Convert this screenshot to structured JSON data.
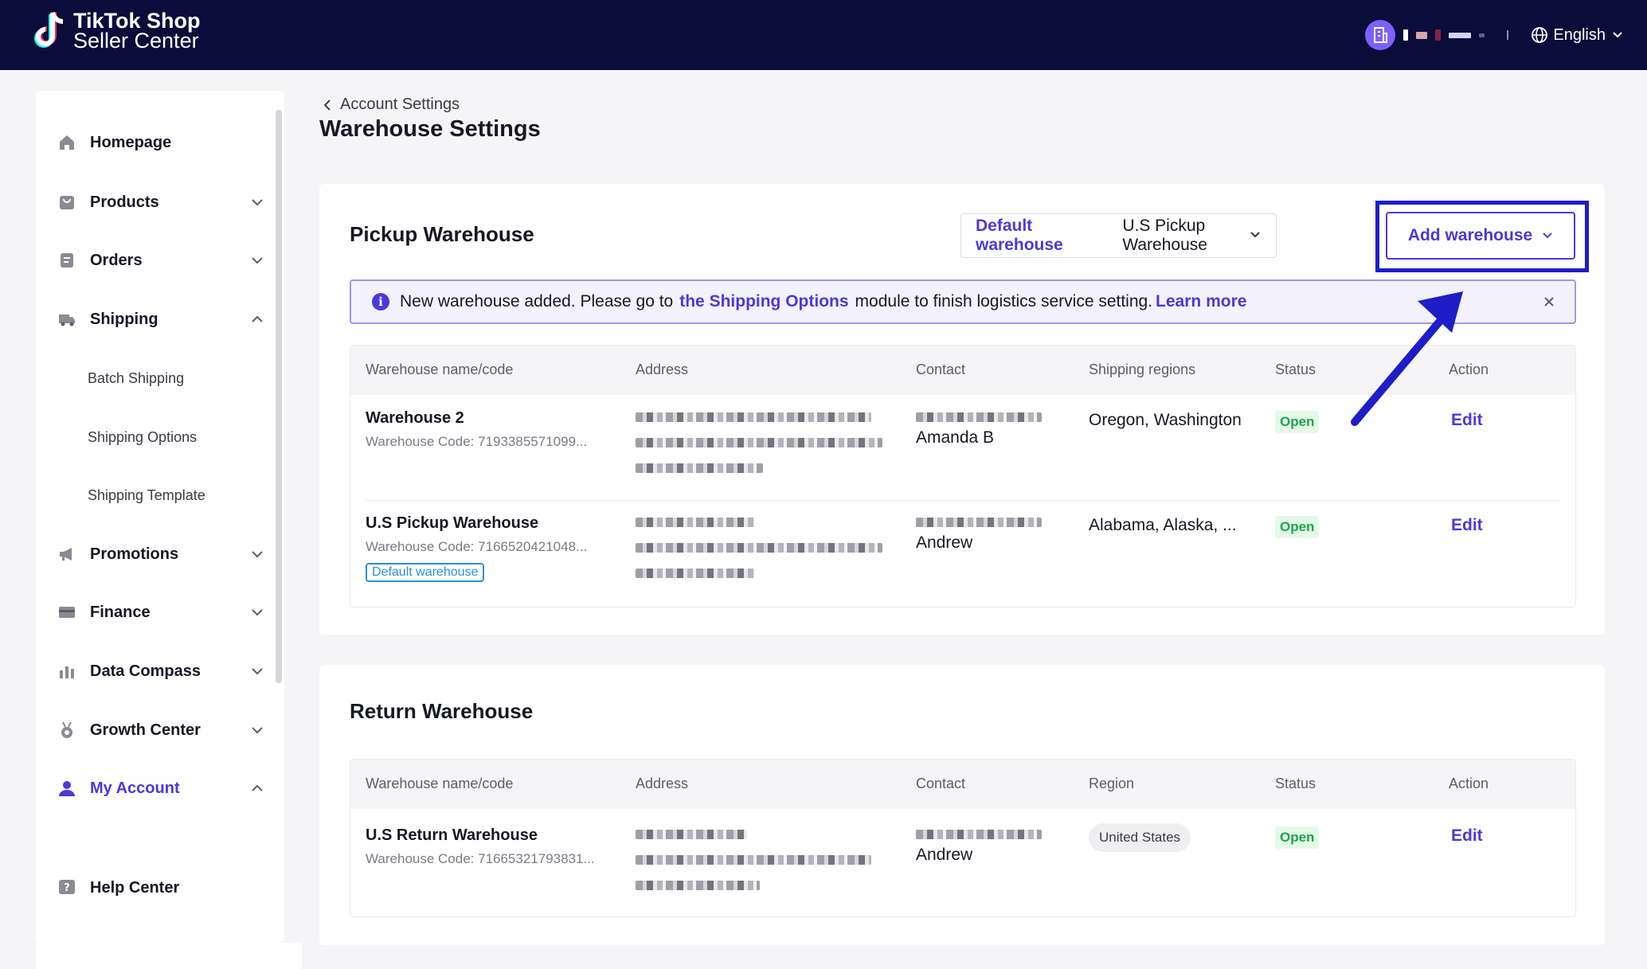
{
  "header": {
    "brand_line1": "TikTok Shop",
    "brand_line2": "Seller Center",
    "language": "English"
  },
  "sidebar": {
    "items": [
      {
        "label": "Homepage"
      },
      {
        "label": "Products"
      },
      {
        "label": "Orders"
      },
      {
        "label": "Shipping"
      },
      {
        "label": "Promotions"
      },
      {
        "label": "Finance"
      },
      {
        "label": "Data Compass"
      },
      {
        "label": "Growth Center"
      },
      {
        "label": "My Account"
      },
      {
        "label": "Help Center"
      }
    ],
    "shipping_subitems": [
      {
        "label": "Batch Shipping"
      },
      {
        "label": "Shipping Options"
      },
      {
        "label": "Shipping Template"
      }
    ]
  },
  "breadcrumb": {
    "parent": "Account Settings"
  },
  "page_title": "Warehouse Settings",
  "pickup": {
    "title": "Pickup Warehouse",
    "default_label": "Default warehouse",
    "default_value": "U.S Pickup Warehouse",
    "add_button": "Add warehouse",
    "banner": {
      "text_before": "New warehouse added. Please go to",
      "link": "the Shipping Options",
      "text_after": "module to finish logistics service setting.",
      "learn_more": "Learn more"
    },
    "columns": [
      "Warehouse name/code",
      "Address",
      "Contact",
      "Shipping regions",
      "Status",
      "Action"
    ],
    "rows": [
      {
        "name": "Warehouse 2",
        "code": "Warehouse Code: 7193385571099...",
        "contact_name": "Amanda B",
        "regions": "Oregon, Washington",
        "status": "Open",
        "action": "Edit"
      },
      {
        "name": "U.S Pickup Warehouse",
        "code": "Warehouse Code: 7166520421048...",
        "tag": "Default warehouse",
        "contact_name": "Andrew",
        "regions": "Alabama, Alaska, ...",
        "status": "Open",
        "action": "Edit"
      }
    ]
  },
  "return": {
    "title": "Return Warehouse",
    "columns": [
      "Warehouse name/code",
      "Address",
      "Contact",
      "Region",
      "Status",
      "Action"
    ],
    "rows": [
      {
        "name": "U.S Return Warehouse",
        "code": "Warehouse Code: 71665321793831...",
        "contact_name": "Andrew",
        "region": "United States",
        "status": "Open",
        "action": "Edit"
      }
    ]
  },
  "colors": {
    "topbar": "#0a0d3a",
    "accent": "#4c39d9",
    "annotation": "#1e1ec8",
    "open_green": "#1aa84a"
  }
}
